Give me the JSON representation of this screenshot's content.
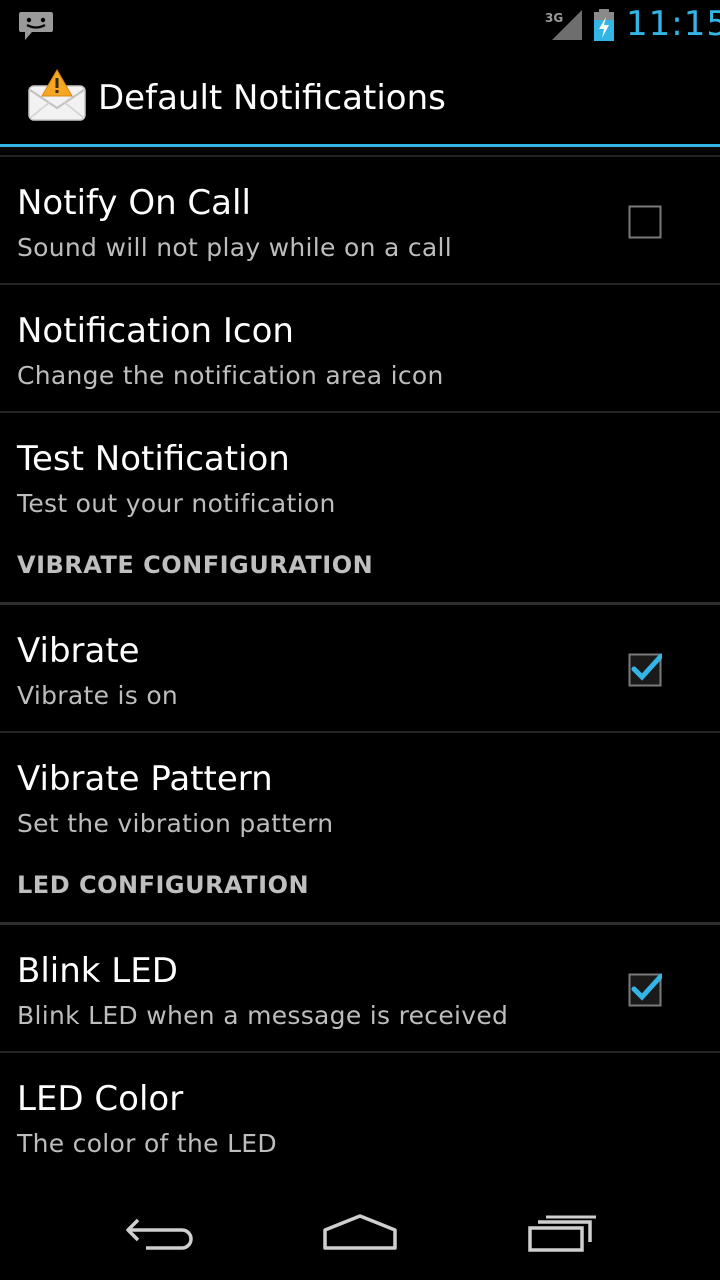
{
  "status_bar": {
    "network": "3G",
    "time": "11:15",
    "icons": [
      "message-icon",
      "signal-icon",
      "battery-charging-icon"
    ]
  },
  "action_bar": {
    "title": "Default Notifications",
    "icon": "mail-warning-icon"
  },
  "preferences": {
    "notify_on_call": {
      "title": "Notify On Call",
      "summary": "Sound will not play while on a call",
      "checked": false
    },
    "notification_icon": {
      "title": "Notification Icon",
      "summary": "Change the notification area icon"
    },
    "test_notification": {
      "title": "Test Notification",
      "summary": "Test out your notification"
    },
    "vibrate_category": "VIBRATE CONFIGURATION",
    "vibrate": {
      "title": "Vibrate",
      "summary": "Vibrate is on",
      "checked": true
    },
    "vibrate_pattern": {
      "title": "Vibrate Pattern",
      "summary": "Set the vibration pattern"
    },
    "led_category": "LED CONFIGURATION",
    "blink_led": {
      "title": "Blink LED",
      "summary": "Blink LED when a message is received",
      "checked": true
    },
    "led_color": {
      "title": "LED Color",
      "summary": "The color of the LED"
    }
  },
  "nav_bar": {
    "icons": [
      "back-icon",
      "home-icon",
      "recent-apps-icon"
    ]
  },
  "colors": {
    "accent": "#33b5e5",
    "background": "#000000",
    "summary_text": "#bdbdbd"
  }
}
